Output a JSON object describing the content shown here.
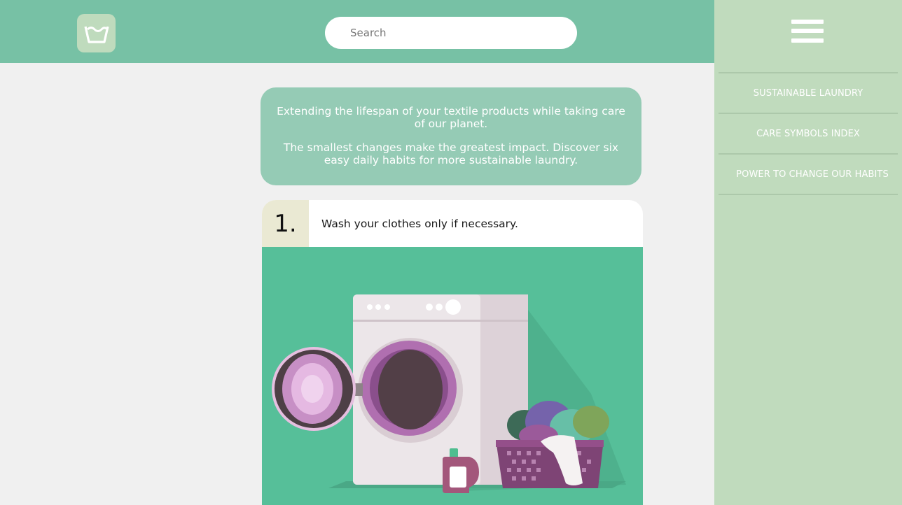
{
  "header": {
    "logo_icon": "wash-tub-icon",
    "search": {
      "placeholder": "Search",
      "value": ""
    }
  },
  "sidebar": {
    "menu_icon": "hamburger-menu-icon",
    "items": [
      {
        "label": "SUSTAINABLE LAUNDRY"
      },
      {
        "label": "CARE SYMBOLS INDEX"
      },
      {
        "label": "POWER TO CHANGE OUR HABITS"
      }
    ]
  },
  "intro": {
    "paragraph1": "Extending the lifespan of your textile products while taking care of our planet.",
    "paragraph2": "The smallest changes make the greatest impact. Discover six easy daily habits for more sustainable laundry."
  },
  "tips": [
    {
      "number": "1.",
      "text": "Wash your clothes only if necessary.",
      "illustration": "washing-machine-laundry-basket-illustration"
    }
  ],
  "colors": {
    "header": "#77c1a5",
    "sidebar": "#c0dbbd",
    "intro_card": "#95cbb5",
    "illustration_bg": "#56bf99",
    "number_badge": "#eae9d3"
  }
}
